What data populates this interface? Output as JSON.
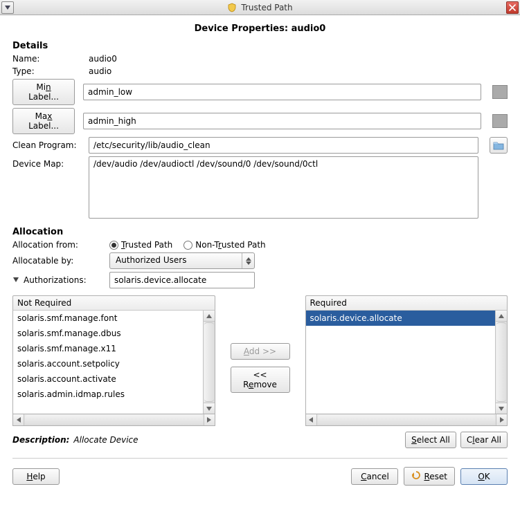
{
  "window": {
    "title": "Trusted Path"
  },
  "page": {
    "title": "Device Properties: audio0"
  },
  "details": {
    "section": "Details",
    "name_label": "Name:",
    "name_value": "audio0",
    "type_label": "Type:",
    "type_value": "audio",
    "min_label_btn": "Min Label...",
    "min_label_value": "admin_low",
    "max_label_btn": "Max Label...",
    "max_label_value": "admin_high",
    "clean_program_label": "Clean Program:",
    "clean_program_value": "/etc/security/lib/audio_clean",
    "device_map_label": "Device Map:",
    "device_map_value": "/dev/audio /dev/audioctl /dev/sound/0 /dev/sound/0ctl"
  },
  "allocation": {
    "section": "Allocation",
    "from_label": "Allocation from:",
    "radio_trusted": "Trusted Path",
    "radio_nontrusted": "Non-Trusted Path",
    "allocatable_label": "Allocatable by:",
    "allocatable_value": "Authorized Users",
    "authorizations_label": "Authorizations:",
    "authorizations_value": "solaris.device.allocate",
    "not_required_header": "Not Required",
    "required_header": "Required",
    "not_required_items": [
      "solaris.smf.manage.font",
      "solaris.smf.manage.dbus",
      "solaris.smf.manage.x11",
      "solaris.account.setpolicy",
      "solaris.account.activate",
      "solaris.admin.idmap.rules"
    ],
    "required_items": [
      "solaris.device.allocate"
    ],
    "add_btn": "Add >>",
    "remove_btn": "<< Remove",
    "description_label": "Description:",
    "description_value": "Allocate Device",
    "select_all": "Select All",
    "clear_all": "Clear All"
  },
  "footer": {
    "help": "Help",
    "cancel": "Cancel",
    "reset": "Reset",
    "ok": "OK"
  }
}
